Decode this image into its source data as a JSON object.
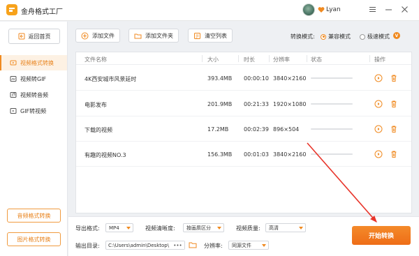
{
  "app": {
    "title": "金舟格式工厂",
    "username": "Lyan"
  },
  "sidebar": {
    "back_label": "返回首页",
    "items": [
      {
        "label": "视频格式转换",
        "active": true
      },
      {
        "label": "视频转GIF",
        "active": false
      },
      {
        "label": "视频转音频",
        "active": false
      },
      {
        "label": "GIF转视频",
        "active": false
      }
    ],
    "audio_convert_label": "音频格式转换",
    "image_convert_label": "图片格式转换"
  },
  "toolbar": {
    "add_file_label": "添加文件",
    "add_folder_label": "添加文件夹",
    "clear_list_label": "清空列表",
    "mode_label": "转换模式:",
    "mode_compatible": "兼容模式",
    "mode_fast": "极速模式",
    "vip_badge": "V"
  },
  "table": {
    "headers": [
      "文件名称",
      "大小",
      "时长",
      "分辨率",
      "状态",
      "操作"
    ],
    "rows": [
      {
        "name": "4K西安城市风景延时",
        "size": "393.4MB",
        "duration": "00:00:10",
        "resolution": "3840×2160"
      },
      {
        "name": "电影发布",
        "size": "201.9MB",
        "duration": "00:21:33",
        "resolution": "1920×1080"
      },
      {
        "name": "下载的视频",
        "size": "17.2MB",
        "duration": "00:02:39",
        "resolution": "896×504"
      },
      {
        "name": "有趣的视频NO.3",
        "size": "156.3MB",
        "duration": "00:01:03",
        "resolution": "3840×2160"
      }
    ]
  },
  "bottom": {
    "output_format_label": "导出格式:",
    "output_format_value": "MP4",
    "clarity_label": "视频清晰度:",
    "clarity_value": "按画质区分",
    "quality_label": "视频质量:",
    "quality_value": "高清",
    "output_dir_label": "输出目录:",
    "output_dir_value": "C:\\Users\\admin\\Desktop\\",
    "more_label": "•••",
    "resolution_label": "分辨率:",
    "resolution_value": "同源文件",
    "start_label": "开始转换"
  },
  "colors": {
    "accent": "#f08a20",
    "start_button": "#ef7420",
    "arrow": "#e8352b"
  }
}
